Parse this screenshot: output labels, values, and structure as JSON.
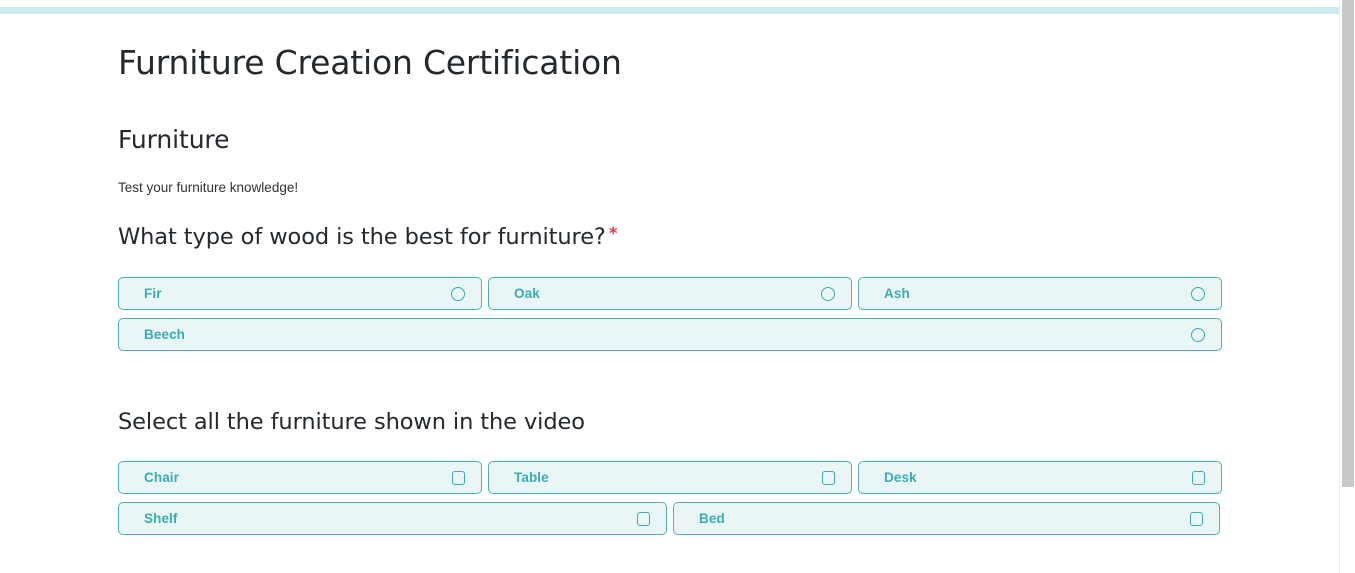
{
  "form": {
    "title": "Furniture Creation Certification",
    "section_title": "Furniture",
    "section_description": "Test your furniture knowledge!"
  },
  "theme": {
    "accent": "#3aacb4",
    "option_border": "#4bb3b3",
    "option_fill": "#e9f6f5",
    "top_bar": "#cfeaee",
    "required_star": "#e03e52",
    "heading_text": "#24292e"
  },
  "questions": [
    {
      "title": "What type of wood is the best for furniture?",
      "required": true,
      "required_marker": "*",
      "input_type": "radio",
      "options": [
        {
          "label": "Fir",
          "checked": false
        },
        {
          "label": "Oak",
          "checked": false
        },
        {
          "label": "Ash",
          "checked": false
        },
        {
          "label": "Beech",
          "checked": false
        }
      ]
    },
    {
      "title": "Select all the furniture shown in the video",
      "required": false,
      "required_marker": "",
      "input_type": "checkbox",
      "options": [
        {
          "label": "Chair",
          "checked": false
        },
        {
          "label": "Table",
          "checked": false
        },
        {
          "label": "Desk",
          "checked": false
        },
        {
          "label": "Shelf",
          "checked": false
        },
        {
          "label": "Bed",
          "checked": false
        }
      ]
    }
  ]
}
